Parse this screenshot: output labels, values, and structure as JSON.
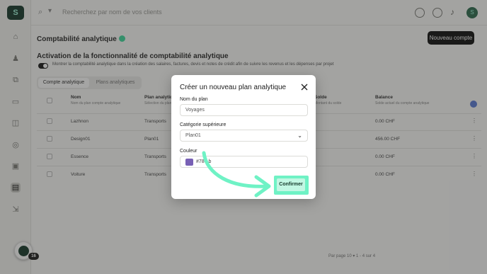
{
  "topbar": {
    "search_placeholder": "Recherchez par nom de vos clients",
    "avatar_initial": "S"
  },
  "page": {
    "title": "Comptabilité analytique",
    "new_account_label": "Nouveau compte",
    "section_title": "Activation de la fonctionnalité de comptabilité analytique",
    "toggle_description": "Montrer la comptabilité analytique dans la création des salaires, factures, devis et notes de crédit afin de suivre les revenus et les dépenses par projet",
    "tabs": [
      "Compte analytique",
      "Plans analytiques"
    ]
  },
  "table": {
    "headers": [
      {
        "label": "Nom",
        "sub": "Nom du plan compte analytique"
      },
      {
        "label": "Plan analytique",
        "sub": "Sélection du plan analytique"
      },
      {
        "label": "Solde",
        "sub": "Montant du solde"
      },
      {
        "label": "Balance",
        "sub": "Solde actuel du compte analytique"
      }
    ],
    "rows": [
      {
        "name": "Lazhnon",
        "plan": "Transports",
        "balance": "0.00 CHF"
      },
      {
        "name": "Design01",
        "plan": "Plan01",
        "balance": "456.00 CHF"
      },
      {
        "name": "Essence",
        "plan": "Transports",
        "balance": "0.00 CHF"
      },
      {
        "name": "Voiture",
        "plan": "Transports",
        "balance": "0.00 CHF"
      }
    ],
    "pager_text": "Par page   10   ▾         1 - 4 sur 4"
  },
  "fab": {
    "badge": "16"
  },
  "modal": {
    "title": "Créer un nouveau plan analytique",
    "name_label": "Nom du plan",
    "name_value": "Voyages",
    "category_label": "Catégorie supérieure",
    "category_value": "Plan01",
    "color_label": "Couleur",
    "color_value": "#7860b5",
    "color_display": "#786 b",
    "confirm_label": "Confirmer"
  },
  "colors": {
    "accent": "#6ff2c5",
    "swatch": "#7860b5",
    "brand_dark": "#173a2c"
  },
  "icons": [
    "search-icon",
    "chevron-down-icon",
    "close-icon",
    "bell-icon",
    "help-icon",
    "settings-icon",
    "arrow-annotation-icon"
  ]
}
